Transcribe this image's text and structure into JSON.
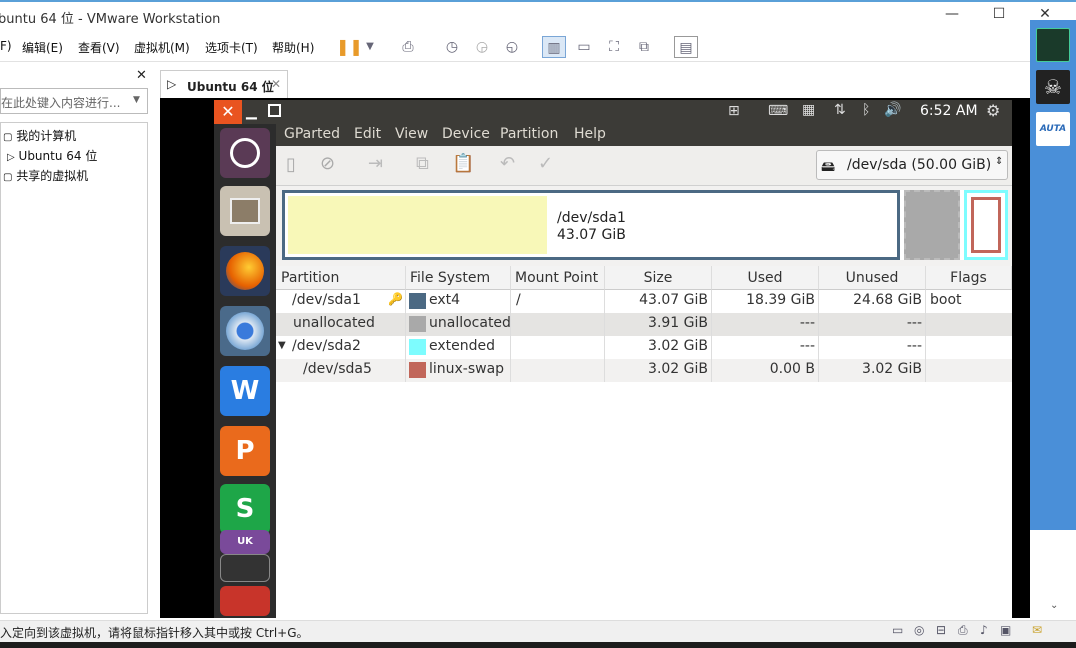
{
  "window": {
    "title": "buntu 64 位 - VMware Workstation",
    "min": "—",
    "max": "☐",
    "close": "✕"
  },
  "menu": [
    "F)",
    "编辑(E)",
    "查看(V)",
    "虚拟机(M)",
    "选项卡(T)",
    "帮助(H)"
  ],
  "library": {
    "close": "✕",
    "search_placeholder": "在此处键入内容进行...",
    "tree": [
      "我的计算机",
      "Ubuntu 64 位",
      "共享的虚拟机"
    ]
  },
  "tab": {
    "label": "Ubuntu 64 位",
    "close": "✕"
  },
  "ubuntu": {
    "time": "6:52 AM"
  },
  "gparted": {
    "menu": [
      "GParted",
      "Edit",
      "View",
      "Device",
      "Partition",
      "Help"
    ],
    "device": "/dev/sda  (50.00 GiB)",
    "map": {
      "name": "/dev/sda1",
      "size": "43.07 GiB"
    },
    "columns": [
      "Partition",
      "File System",
      "Mount Point",
      "Size",
      "Used",
      "Unused",
      "Flags"
    ],
    "rows": [
      {
        "partition": "/dev/sda1",
        "fs": "ext4",
        "mount": "/",
        "size": "43.07 GiB",
        "used": "18.39 GiB",
        "unused": "24.68 GiB",
        "flags": "boot",
        "color": "#4b6983"
      },
      {
        "partition": "unallocated",
        "fs": "unallocated",
        "mount": "",
        "size": "3.91 GiB",
        "used": "---",
        "unused": "---",
        "flags": "",
        "color": "#a9a9a9"
      },
      {
        "partition": "/dev/sda2",
        "fs": "extended",
        "mount": "",
        "size": "3.02 GiB",
        "used": "---",
        "unused": "---",
        "flags": "",
        "color": "#7dfcfe"
      },
      {
        "partition": "/dev/sda5",
        "fs": "linux-swap",
        "mount": "",
        "size": "3.02 GiB",
        "used": "0.00 B",
        "unused": "3.02 GiB",
        "flags": "",
        "color": "#c1665a"
      }
    ]
  },
  "status": {
    "text": "入定向到该虚拟机，请将鼠标指针移入其中或按 Ctrl+G。"
  }
}
